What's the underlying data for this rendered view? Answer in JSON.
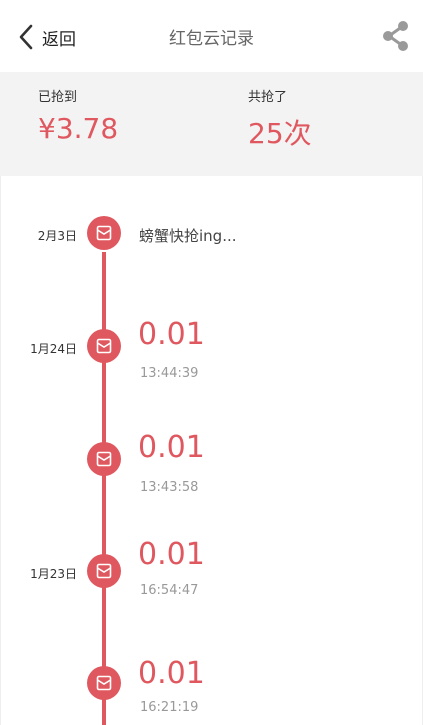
{
  "navbar": {
    "back_label": "返回",
    "title": "红包云记录",
    "back_icon": "chevron-left-icon",
    "share_icon": "share-icon"
  },
  "summary": {
    "grabbed_label": "已抢到",
    "grabbed_value": "¥3.78",
    "count_label": "共抢了",
    "count_value": "25次"
  },
  "entries": [
    {
      "date": "2月3日",
      "pending_text": "螃蟹快抢ing..."
    },
    {
      "date": "1月24日",
      "amount": "0.01",
      "time": "13:44:39"
    },
    {
      "date": "",
      "amount": "0.01",
      "time": "13:43:58"
    },
    {
      "date": "1月23日",
      "amount": "0.01",
      "time": "16:54:47"
    },
    {
      "date": "",
      "amount": "0.01",
      "time": "16:21:19"
    }
  ],
  "colors": {
    "accent": "#e0585f",
    "summary_bg": "#f3f3f3"
  }
}
